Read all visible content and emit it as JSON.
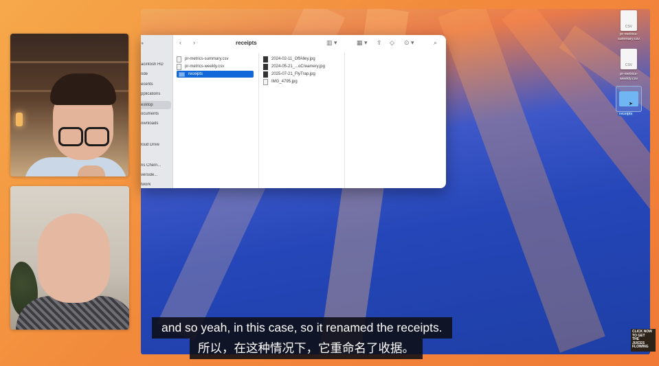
{
  "finder": {
    "title": "receipts",
    "sidebar_items": [
      {
        "label": "acintosh HD"
      },
      {
        "label": "ode"
      },
      {
        "label": "ecents"
      },
      {
        "label": "pplications"
      },
      {
        "label": "esktop"
      },
      {
        "label": "ocuments"
      },
      {
        "label": "ownloads"
      },
      {
        "label": "loud Drive"
      },
      {
        "label": "ris Chern..."
      },
      {
        "label": "verside..."
      },
      {
        "label": "twork"
      }
    ],
    "column1": [
      {
        "name": "pr-metrics-summary.csv",
        "icon": "document-icon"
      },
      {
        "name": "pr-metrics-weekly.csv",
        "icon": "document-icon"
      },
      {
        "name": "receipts",
        "icon": "folder-icon"
      }
    ],
    "column2": [
      {
        "name": "2024-02-11_OffAlley.jpg",
        "icon": "image-icon"
      },
      {
        "name": "2024-05-21_...oCreamery.jpg",
        "icon": "image-icon"
      },
      {
        "name": "2025-07-21_FlyTrap.jpg",
        "icon": "image-icon"
      },
      {
        "name": "IMG_4795.jpg",
        "icon": "document-icon"
      }
    ]
  },
  "desktop_items": [
    {
      "label1": "pr-metrics-",
      "label2": "summary.csv",
      "badge": "CSV"
    },
    {
      "label1": "pr-metrics-",
      "label2": "weekly.csv",
      "badge": "CSV"
    },
    {
      "label1": "receipts",
      "label2": ""
    }
  ],
  "subtitles": {
    "english": "and so yeah, in this case, so it renamed the receipts.",
    "chinese": "所以，在这种情况下，它重命名了收据。"
  },
  "badge": {
    "line1": "CLICK NOW",
    "line2": "TO GET",
    "line3": "THE",
    "line4": "JUICES",
    "line5": "FLOWING"
  },
  "colors": {
    "selection": "#1268d8",
    "accent_orange": "#f28a3c"
  }
}
